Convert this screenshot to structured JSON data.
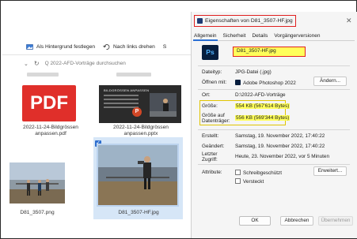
{
  "explorer": {
    "toolbar": [
      {
        "label": "Als Hintergrund festlegen",
        "icon": "wallpaper-icon"
      },
      {
        "label": "Nach links drehen",
        "icon": "rotate-left-icon"
      },
      {
        "label": "S"
      }
    ],
    "search_placeholder": "Q  2022-AFD-Vorträge durchsuchen",
    "files": [
      {
        "name": "2022-11-24-Bildgrössen anpassen.pdf",
        "line1": "2022-11-24-Bildgrössen",
        "line2": "anpassen.pdf",
        "thumb_text": "PDF"
      },
      {
        "name": "2022-11-24-Bildgrössen anpassen.pptx",
        "line1": "2022-11-24-Bildgrössen",
        "line2": "anpassen.pptx",
        "thumb_text": "BILDGRÖSSEN ANPASSEN"
      },
      {
        "name": "D81_3507.png",
        "line1": "D81_3507.png"
      },
      {
        "name": "D81_3507-HF.jpg",
        "line1": "D81_3507-HF.jpg",
        "selected": true
      }
    ]
  },
  "dialog": {
    "title": "Eigenschaften von D81_3507-HF.jpg",
    "tabs": [
      "Allgemein",
      "Sicherheit",
      "Details",
      "Vorgängerversionen"
    ],
    "active_tab": "Allgemein",
    "filename": "D81_3507-HF.jpg",
    "app_icon_text": "Ps",
    "rows": {
      "dateityp_label": "Dateityp:",
      "dateityp_value": "JPG-Datei (.jpg)",
      "oeffnen_label": "Öffnen mit:",
      "oeffnen_value": "Adobe Photoshop 2022",
      "aendern_button": "Ändern...",
      "ort_label": "Ort:",
      "ort_value": "D:\\2022-AFD-Vorträge",
      "groesse_label": "Größe:",
      "groesse_value": "554 KB (567'614 Bytes)",
      "groesse_auf_label_1": "Größe auf",
      "groesse_auf_label_2": "Datenträger:",
      "groesse_auf_value": "556 KB (569'344 Bytes)",
      "erstellt_label": "Erstellt:",
      "erstellt_value": "Samstag, 19. November 2022, 17:40:22",
      "geaendert_label": "Geändert:",
      "geaendert_value": "Samstag, 19. November 2022, 17:40:22",
      "zugriff_label_1": "Letzter",
      "zugriff_label_2": "Zugriff:",
      "zugriff_value": "Heute, 23. November 2022, vor 5 Minuten",
      "attribute_label": "Attribute:",
      "schreibgeschuetzt": "Schreibgeschützt",
      "versteckt": "Versteckt",
      "erweitert_button": "Erweitert..."
    },
    "buttons": {
      "ok": "OK",
      "cancel": "Abbrechen",
      "apply": "Übernehmen"
    },
    "colors": {
      "highlight_red": "#e02020",
      "highlight_yellow": "#ffff5a",
      "photoshop_bg": "#061e3e",
      "photoshop_text": "#4fb2ff",
      "pdf_red": "#e02f2a"
    }
  }
}
